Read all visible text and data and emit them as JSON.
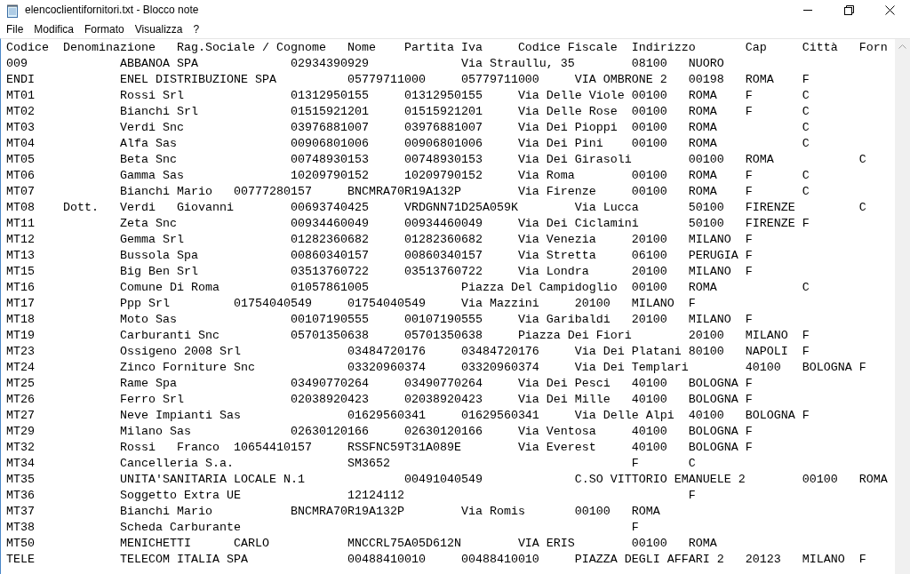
{
  "window": {
    "title": "elencoclientifornitori.txt - Blocco note"
  },
  "menu": [
    "File",
    "Modifica",
    "Formato",
    "Visualizza",
    "?"
  ],
  "lines": [
    "Codice\tDenominazione\tRag.Sociale / Cognome\tNome\tPartita Iva\tCodice Fiscale\tIndirizzo\tCap\tCittà\tForn",
    "009\t\tABBANOA SPA\t\t02934390929\t\tVia Straullu, 35\t08100\tNUORO",
    "ENDI\t\tENEL DISTRIBUZIONE SPA\t\t05779711000\t05779711000\tVIA OMBRONE 2\t00198\tROMA\tF",
    "MT01\t\tRossi Srl\t\t01312950155\t01312950155\tVia Delle Viole\t00100\tROMA\tF\tC",
    "MT02\t\tBianchi Srl\t\t01515921201\t01515921201\tVia Delle Rose\t00100\tROMA\tF\tC",
    "MT03\t\tVerdi Snc\t\t03976881007\t03976881007\tVia Dei Pioppi\t00100\tROMA\t\tC",
    "MT04\t\tAlfa Sas\t\t00906801006\t00906801006\tVia Dei Pini\t00100\tROMA\t\tC",
    "MT05\t\tBeta Snc\t\t00748930153\t00748930153\tVia Dei Girasoli\t00100\tROMA\t\tC",
    "MT06\t\tGamma Sas\t\t10209790152\t10209790152\tVia Roma\t00100\tROMA\tF\tC",
    "MT07\t\tBianchi Mario\t00777280157\tBNCMRA70R19A132P\tVia Firenze\t00100\tROMA\tF\tC",
    "MT08\tDott.\tVerdi\tGiovanni\t00693740425\tVRDGNN71D25A059K\tVia Lucca\t50100\tFIRENZE\t\tC",
    "MT11\t\tZeta Snc\t\t00934460049\t00934460049\tVia Dei Ciclamini\t50100\tFIRENZE\tF",
    "MT12\t\tGemma Srl\t\t01282360682\t01282360682\tVia Venezia\t20100\tMILANO\tF",
    "MT13\t\tBussola Spa\t\t00860340157\t00860340157\tVia Stretta\t06100\tPERUGIA\tF",
    "MT15\t\tBig Ben Srl\t\t03513760722\t03513760722\tVia Londra\t20100\tMILANO\tF",
    "MT16\t\tComune Di Roma\t\t01057861005\t\tPiazza Del Campidoglio\t00100\tROMA\t\tC",
    "MT17\t\tPpp Srl\t\t01754040549\t01754040549\tVia Mazzini\t20100\tMILANO\tF",
    "MT18\t\tMoto Sas\t\t00107190555\t00107190555\tVia Garibaldi\t20100\tMILANO\tF",
    "MT19\t\tCarburanti Snc\t\t05701350638\t05701350638\tPiazza Dei Fiori\t20100\tMILANO\tF",
    "MT23\t\tOssigeno 2008 Srl\t\t03484720176\t03484720176\tVia Dei Platani\t80100\tNAPOLI\tF",
    "MT24\t\tZinco Forniture Snc\t\t03320960374\t03320960374\tVia Dei Templari\t40100\tBOLOGNA\tF",
    "MT25\t\tRame Spa\t\t03490770264\t03490770264\tVia Dei Pesci\t40100\tBOLOGNA\tF",
    "MT26\t\tFerro Srl\t\t02038920423\t02038920423\tVia Dei Mille\t40100\tBOLOGNA\tF",
    "MT27\t\tNeve Impianti Sas\t\t01629560341\t01629560341\tVia Delle Alpi\t40100\tBOLOGNA\tF",
    "MT29\t\tMilano Sas\t\t02630120166\t02630120166\tVia Ventosa\t40100\tBOLOGNA\tF",
    "MT32\t\tRossi\tFranco\t10654410157\tRSSFNC59T31A089E\tVia Everest\t40100\tBOLOGNA\tF",
    "MT34\t\tCancelleria S.a.\t\tSM3652\t\t\t\t\tF\tC",
    "MT35\t\tUNITA'SANITARIA LOCALE N.1\t\t00491040549\t\tC.SO VITTORIO EMANUELE 2\t00100\tROMA",
    "MT36\t\tSoggetto Extra UE\t\t12124112\t\t\t\t\tF",
    "MT37\t\tBianchi Mario\t\tBNCMRA70R19A132P\tVia Romis\t00100\tROMA",
    "MT38\t\tScheda Carburante\t\t\t\t\t\t\tF",
    "MT50\t\tMENICHETTI\tCARLO\t\tMNCCRL75A05D612N\tVIA ERIS\t00100\tROMA",
    "TELE\t\tTELECOM ITALIA SPA\t\t00488410010\t00488410010\tPIAZZA DEGLI AFFARI 2\t20123\tMILANO\tF"
  ]
}
